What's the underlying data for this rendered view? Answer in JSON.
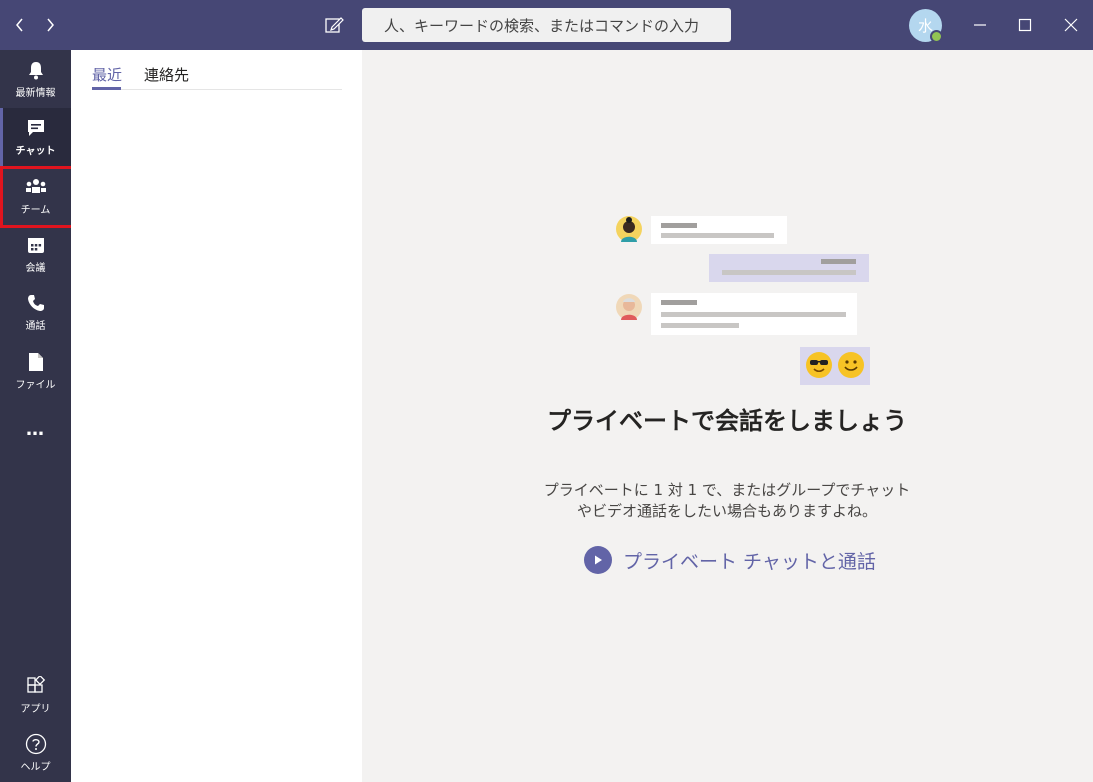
{
  "titlebar": {
    "search_placeholder": "人、キーワードの検索、またはコマンドの入力",
    "avatar_initial": "水"
  },
  "rail": {
    "items": [
      {
        "label": "最新情報",
        "icon": "bell-icon"
      },
      {
        "label": "チャット",
        "icon": "chat-icon"
      },
      {
        "label": "チーム",
        "icon": "teams-icon"
      },
      {
        "label": "会議",
        "icon": "calendar-icon"
      },
      {
        "label": "通話",
        "icon": "phone-icon"
      },
      {
        "label": "ファイル",
        "icon": "file-icon"
      }
    ],
    "more": "…",
    "apps_label": "アプリ",
    "help_label": "ヘルプ"
  },
  "list": {
    "tabs": [
      {
        "label": "最近"
      },
      {
        "label": "連絡先"
      }
    ]
  },
  "main": {
    "heading": "プライベートで会話をしましょう",
    "subtext": "プライベートに 1 対 1 で、またはグループでチャットやビデオ通話をしたい場合もありますよね。",
    "cta_label": "プライベート チャットと通話"
  },
  "colors": {
    "titlebar": "#464775",
    "rail": "#33344a",
    "accent": "#6264a7",
    "highlight": "#e0141e"
  }
}
